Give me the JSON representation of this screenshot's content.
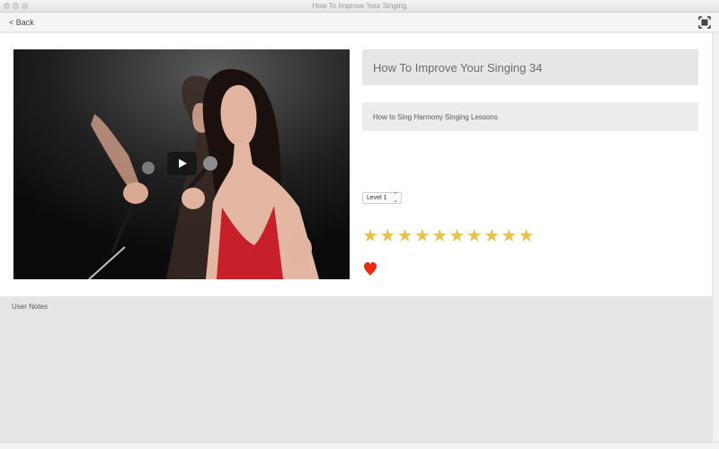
{
  "window": {
    "title": "How To Improve Your Singing"
  },
  "toolbar": {
    "back_label": "< Back",
    "fullscreen_icon": "fullscreen-icon"
  },
  "lesson": {
    "title": "How To Improve Your Singing 34",
    "subtitle": "How to Sing Harmony  Singing Lessons",
    "level": "Level 1",
    "rating_stars": 10,
    "favorite": true
  },
  "notes": {
    "label": "User Notes"
  },
  "colors": {
    "star": "#e9c24a",
    "heart": "#ee2a13",
    "panel": "#e6e6e6"
  }
}
